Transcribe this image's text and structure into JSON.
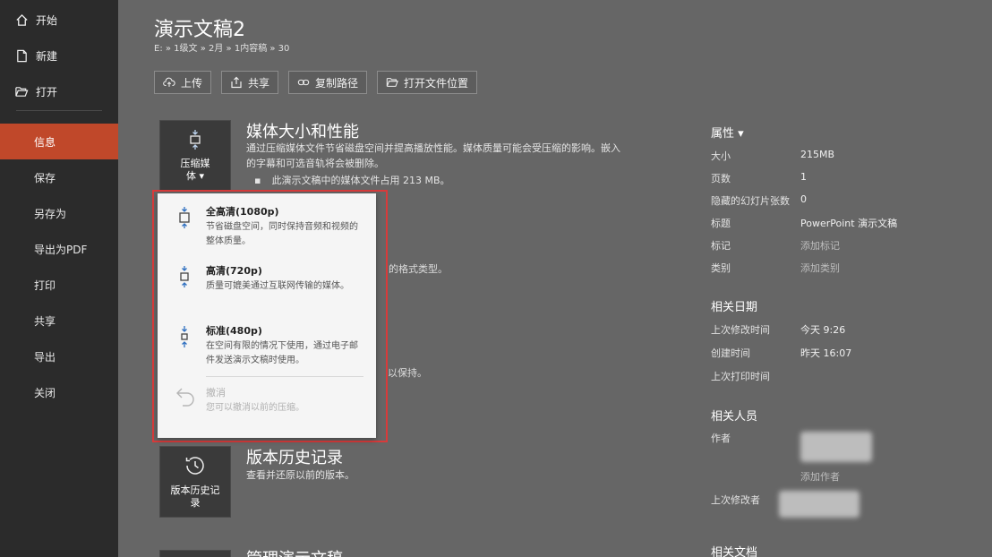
{
  "sidebar": {
    "top": [
      {
        "label": "开始",
        "icon": "home-icon"
      },
      {
        "label": "新建",
        "icon": "new-file-icon"
      },
      {
        "label": "打开",
        "icon": "folder-open-icon"
      }
    ],
    "items": [
      "信息",
      "保存",
      "另存为",
      "导出为PDF",
      "打印",
      "共享",
      "导出",
      "关闭"
    ],
    "active_index": 0
  },
  "header": {
    "title": "演示文稿2",
    "path": "E: » 1级文 » 2月 » 1内容稿 » 30"
  },
  "toolbar": {
    "upload": "上传",
    "share": "共享",
    "copy_path": "复制路径",
    "open_location": "打开文件位置"
  },
  "media": {
    "tile_label_1": "压缩媒",
    "tile_label_2": "体 ▾",
    "title": "媒体大小和性能",
    "desc_1": "通过压缩媒体文件节省磁盘空间并提高播放性能。媒体质量可能会受压缩的影响。嵌入",
    "desc_2": "的字幕和可选音轨将会被删除。",
    "bullet": "此演示文稿中的媒体文件占用 213 MB。"
  },
  "partials": {
    "p1": "的格式类型。",
    "p2": "以保持。"
  },
  "dropdown": {
    "options": [
      {
        "title": "全高清(1080p)",
        "desc": "节省磁盘空间，同时保持音频和视频的整体质量。"
      },
      {
        "title": "高清(720p)",
        "desc": "质量可媲美通过互联网传输的媒体。"
      },
      {
        "title": "标准(480p)",
        "desc": "在空间有限的情况下使用，通过电子邮件发送演示文稿时使用。"
      }
    ],
    "undo": {
      "title": "撤消",
      "desc": "您可以撤消以前的压缩。"
    }
  },
  "history": {
    "tile_label_1": "版本历史记",
    "tile_label_2": "录",
    "title": "版本历史记录",
    "desc": "查看并还原以前的版本。"
  },
  "manage": {
    "title": "管理演示文稿"
  },
  "properties": {
    "heading": "属性 ▾",
    "rows": [
      {
        "label": "大小",
        "value": "215MB"
      },
      {
        "label": "页数",
        "value": "1"
      },
      {
        "label": "隐藏的幻灯片张数",
        "value": "0"
      },
      {
        "label": "标题",
        "value": "PowerPoint 演示文稿"
      },
      {
        "label": "标记",
        "value": "添加标记"
      },
      {
        "label": "类别",
        "value": "添加类别"
      }
    ]
  },
  "related_dates": {
    "heading": "相关日期",
    "rows": [
      {
        "label": "上次修改时间",
        "value": "今天 9:26"
      },
      {
        "label": "创建时间",
        "value": "昨天 16:07"
      },
      {
        "label": "上次打印时间",
        "value": ""
      }
    ]
  },
  "related_people": {
    "heading": "相关人员",
    "author_label": "作者",
    "add_author": "添加作者",
    "last_modified_by_label": "上次修改者"
  },
  "related_docs": {
    "heading": "相关文档"
  }
}
